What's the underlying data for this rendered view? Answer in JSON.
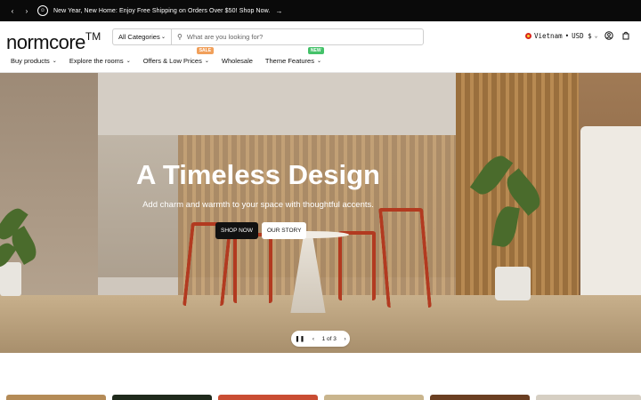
{
  "announcement": {
    "prev_arrow": "‹",
    "next_arrow": "›",
    "text": "New Year, New Home: Enjoy Free Shipping on Orders Over $50! Shop Now.",
    "cta_arrow": "→"
  },
  "header": {
    "logo": "normcore",
    "logo_tm": "TM",
    "search": {
      "category_label": "All Categories",
      "placeholder": "What are you looking for?"
    },
    "locale": {
      "country": "Vietnam",
      "separator": "•",
      "currency": "USD $"
    }
  },
  "nav": {
    "items": [
      {
        "label": "Buy products"
      },
      {
        "label": "Explore the rooms"
      },
      {
        "label": "Offers & Low Prices",
        "badge": "SALE"
      },
      {
        "label": "Wholesale"
      },
      {
        "label": "Theme Features",
        "badge": "NEW"
      }
    ]
  },
  "hero": {
    "title": "A Timeless Design",
    "subtitle": "Add charm and warmth to your space with thoughtful accents.",
    "primary_cta": "SHOP NOW",
    "secondary_cta": "OUR STORY",
    "slide_indicator": "1 of 3"
  },
  "colors": {
    "topbar": "#0a0a0a",
    "sale_badge": "#f1a05b",
    "new_badge": "#45c26a"
  }
}
